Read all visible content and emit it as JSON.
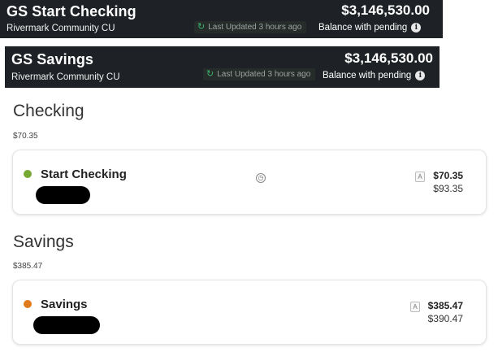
{
  "banners": [
    {
      "title": "GS Start Checking",
      "institution": "Rivermark Community CU",
      "amount": "$3,146,530.00",
      "last_updated": "Last Updated 3 hours ago",
      "pending_label": "Balance with pending",
      "info_icon": "i"
    },
    {
      "title": "GS Savings",
      "institution": "Rivermark Community CU",
      "amount": "$3,146,530.00",
      "last_updated": "Last Updated 3 hours ago",
      "pending_label": "Balance with pending",
      "info_icon": "i"
    }
  ],
  "sections": {
    "checking": {
      "heading": "Checking",
      "total": "$70.35",
      "account": {
        "name": "Start Checking",
        "dot_color": "#76a832",
        "badge": "A",
        "available": "$70.35",
        "current": "$93.35",
        "icons": [
          "clock-icon"
        ]
      }
    },
    "savings": {
      "heading": "Savings",
      "total": "$385.47",
      "account": {
        "name": "Savings",
        "dot_color": "#e07b1b",
        "badge": "A",
        "available": "$385.47",
        "current": "$390.47"
      }
    }
  },
  "colors": {
    "banner_bg": "#1e2226",
    "refresh_green": "#3cb371"
  }
}
